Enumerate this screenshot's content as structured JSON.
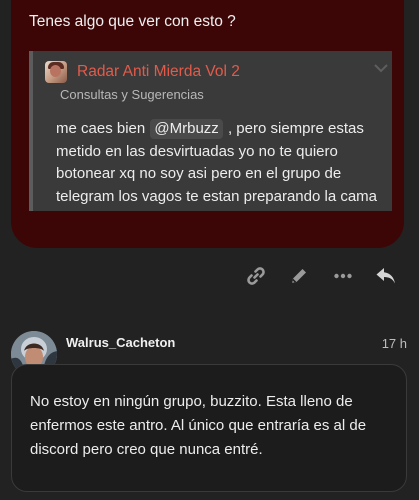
{
  "previous_post": {
    "text": "Tenes algo que ver con esto ?",
    "quote": {
      "title": "Radar Anti Mierda Vol 2",
      "category": "Consultas y Sugerencias",
      "body_before": "me caes bien",
      "mention": "@Mrbuzz",
      "body_after": ", pero siempre estas metido en las desvirtuadas yo no te quiero botonear xq no soy asi pero en el grupo de telegram los vagos te estan preparando la cama"
    }
  },
  "actions": {
    "link_icon": "link-icon",
    "edit_icon": "pencil-icon",
    "more_icon": "ellipsis-icon",
    "reply_icon": "reply-icon"
  },
  "reply_post": {
    "author": "Walrus_Cacheton",
    "time": "17 h",
    "text": "No estoy en ningún grupo, buzzito. Esta lleno de enfermos este antro. Al único que entraría es al de discord pero creo que nunca entré."
  },
  "colors": {
    "background": "#222222",
    "message_bg": "#3d0606",
    "quote_bg": "#3a3a3a",
    "quote_title": "#e25b4a"
  }
}
